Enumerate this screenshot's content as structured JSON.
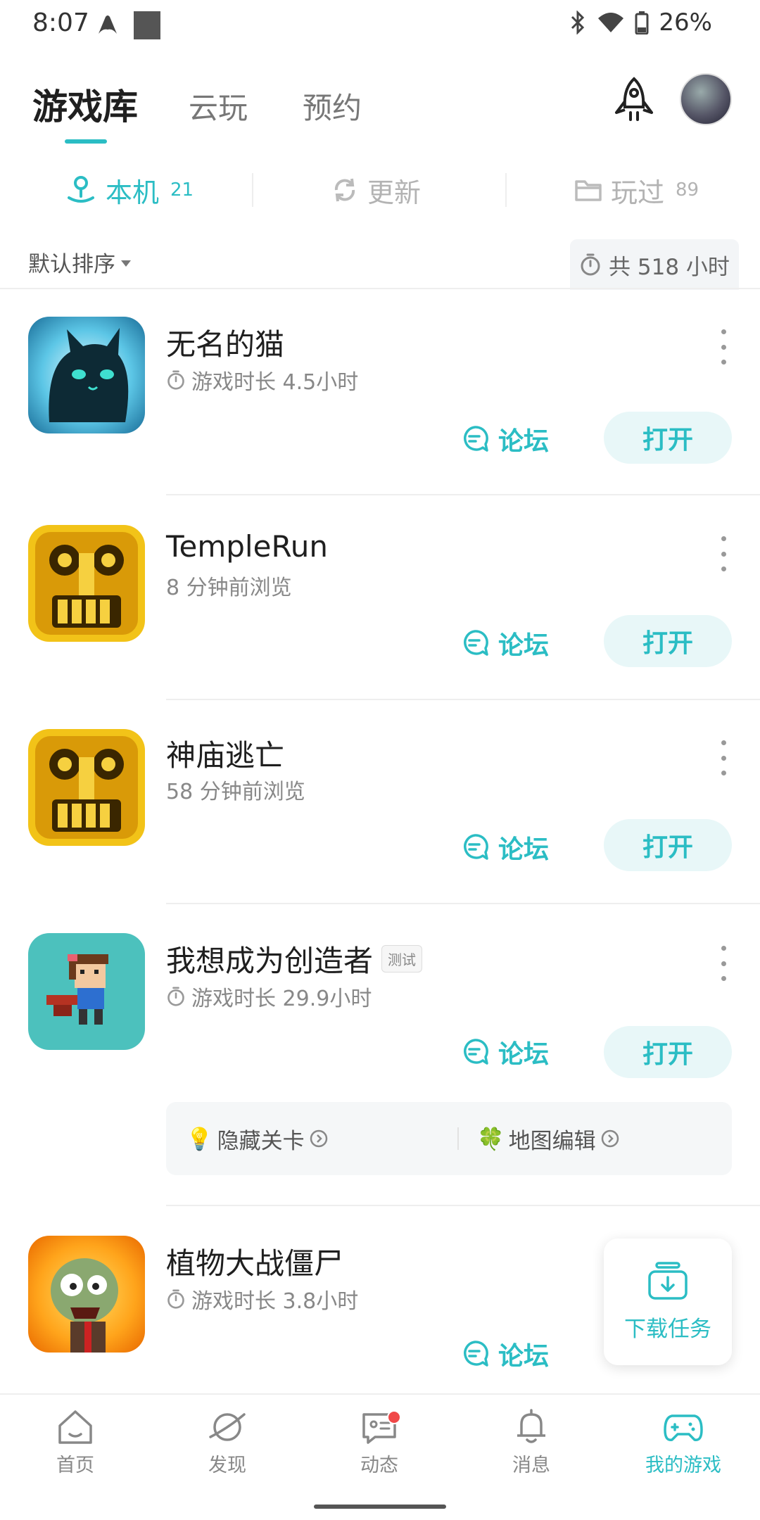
{
  "status_bar": {
    "time": "8:07",
    "battery": "26%"
  },
  "header": {
    "tabs": [
      {
        "label": "游戏库",
        "active": true
      },
      {
        "label": "云玩",
        "active": false
      },
      {
        "label": "预约",
        "active": false
      }
    ],
    "icons": [
      "rocket-icon",
      "avatar"
    ]
  },
  "subtabs": [
    {
      "label": "本机",
      "count": "21",
      "active": true,
      "icon": "phone-hand-icon"
    },
    {
      "label": "更新",
      "count": "",
      "active": false,
      "icon": "refresh-icon"
    },
    {
      "label": "玩过",
      "count": "89",
      "active": false,
      "icon": "folder-icon"
    }
  ],
  "sort": {
    "label": "默认排序",
    "total": "共 518 小时"
  },
  "games": [
    {
      "title": "无名的猫",
      "sub": "游戏时长 4.5小时",
      "timer": true,
      "forum": "论坛",
      "open": "打开"
    },
    {
      "title": "TempleRun",
      "sub": "8 分钟前浏览",
      "timer": false,
      "forum": "论坛",
      "open": "打开"
    },
    {
      "title": "神庙逃亡",
      "sub": "58 分钟前浏览",
      "timer": false,
      "forum": "论坛",
      "open": "打开"
    },
    {
      "title": "我想成为创造者",
      "badge": "测试",
      "sub": "游戏时长 29.9小时",
      "timer": true,
      "forum": "论坛",
      "open": "打开",
      "extras": [
        {
          "icon": "💡",
          "label": "隐藏关卡"
        },
        {
          "icon": "🍀",
          "label": "地图编辑"
        }
      ]
    },
    {
      "title": "植物大战僵尸",
      "sub": "游戏时长 3.8小时",
      "timer": true,
      "forum": "论坛"
    }
  ],
  "download_task": {
    "label": "下载任务"
  },
  "bottom_nav": [
    {
      "label": "首页",
      "icon": "home-icon",
      "active": false
    },
    {
      "label": "发现",
      "icon": "planet-icon",
      "active": false
    },
    {
      "label": "动态",
      "icon": "message-card-icon",
      "active": false,
      "dot": true
    },
    {
      "label": "消息",
      "icon": "bell-icon",
      "active": false
    },
    {
      "label": "我的游戏",
      "icon": "gamepad-icon",
      "active": true
    }
  ],
  "colors": {
    "accent": "#2bbdc4",
    "notify": "#f04848"
  }
}
